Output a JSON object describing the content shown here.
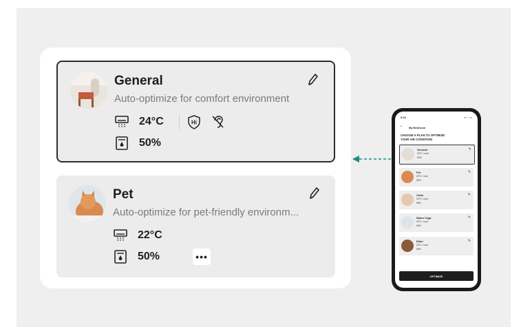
{
  "cards": [
    {
      "title": "General",
      "description": "Auto-optimize for comfort environment",
      "temperature": "24°C",
      "humidity": "50%"
    },
    {
      "title": "Pet",
      "description": "Auto-optimize for pet-friendly environm...",
      "temperature": "22°C",
      "humidity": "50%",
      "more": "•••"
    }
  ],
  "phone": {
    "status_time": "9:41",
    "header": "My Bedroom",
    "heading_line1": "CHOOSE A PLAN TO OPTIMIZE",
    "heading_line2": "YOUR AIR CONDITION",
    "plans": [
      {
        "title": "General",
        "temp": "24°C / cool",
        "hum": "50%"
      },
      {
        "title": "Pet",
        "temp": "22°C / cool",
        "hum": "50%"
      },
      {
        "title": "Child",
        "temp": "24°C / cool",
        "hum": "55%"
      },
      {
        "title": "Warm Yoga",
        "temp": "23°C / cool",
        "hum": "55%"
      },
      {
        "title": "Elder",
        "temp": "26°C / cool",
        "hum": "55%"
      }
    ],
    "button": "OPTIMIZE"
  },
  "colors": {
    "accent_arrow": "#1f8a8a",
    "card_bg": "#ececec",
    "stage_bg": "#efefef"
  }
}
